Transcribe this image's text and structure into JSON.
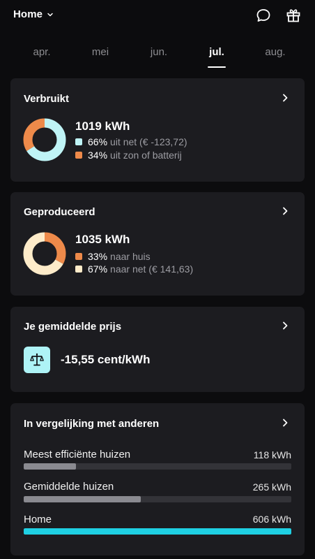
{
  "header": {
    "location": "Home",
    "icons": [
      "chevron-down-icon",
      "chat-bubble-icon",
      "gift-icon"
    ]
  },
  "months": {
    "items": [
      "apr.",
      "mei",
      "jun.",
      "jul.",
      "aug."
    ],
    "active": "jul."
  },
  "consumed": {
    "title": "Verbruikt",
    "total": "1019 kWh",
    "rows": [
      {
        "pct": "66%",
        "text": "uit net (€ -123,72)",
        "fraction": 0.66,
        "color": "#bff4f6"
      },
      {
        "pct": "34%",
        "text": "uit zon of batterij",
        "fraction": 0.34,
        "color": "#ee8a4a"
      }
    ]
  },
  "produced": {
    "title": "Geproduceerd",
    "total": "1035 kWh",
    "rows": [
      {
        "pct": "33%",
        "text": "naar huis",
        "fraction": 0.33,
        "color": "#ee8a4a"
      },
      {
        "pct": "67%",
        "text": "naar net (€ 141,63)",
        "fraction": 0.67,
        "color": "#fdebc9"
      }
    ]
  },
  "avg_price": {
    "title": "Je gemiddelde prijs",
    "value": "-15,55 cent/kWh",
    "icon": "scale-icon"
  },
  "comparison": {
    "title": "In vergelijking met anderen",
    "max_kwh": 606,
    "rows": [
      {
        "label": "Meest efficiënte huizen",
        "value": "118 kWh",
        "kwh": 118
      },
      {
        "label": "Gemiddelde huizen",
        "value": "265 kWh",
        "kwh": 265
      },
      {
        "label": "Home",
        "value": "606 kWh",
        "kwh": 606
      }
    ]
  },
  "colors": {
    "background": "#0c0c0e",
    "card": "#1c1c20",
    "accent_cyan": "#1fd0e3",
    "orange": "#ee8a4a",
    "light_cyan": "#bff4f6",
    "cream": "#fdebc9"
  }
}
